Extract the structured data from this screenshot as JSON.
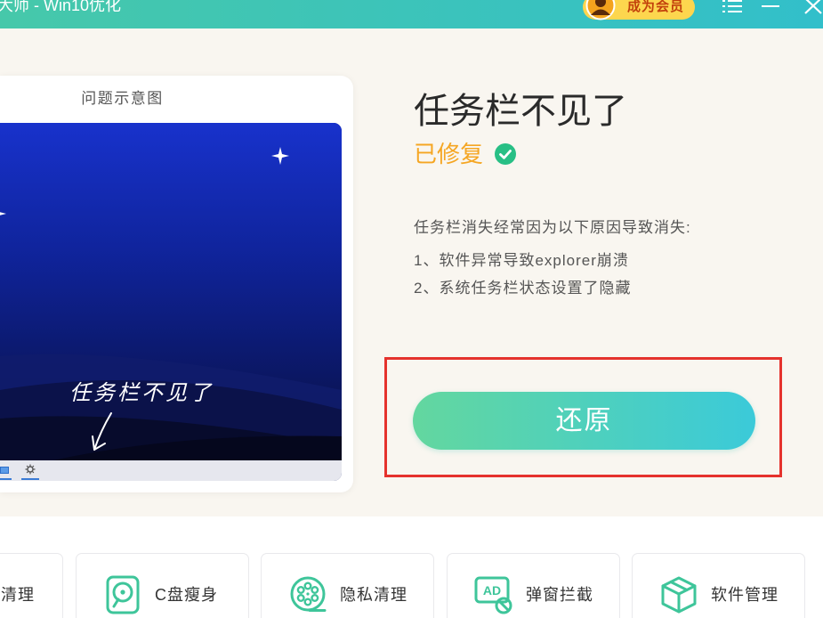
{
  "window": {
    "title": "大师 - Win10优化",
    "vip_label": "成为会员",
    "icons": {
      "avatar": "avatar-icon",
      "menu": "menu-icon",
      "minimize": "minimize-icon",
      "close": "close-icon"
    }
  },
  "preview": {
    "title": "问题示意图",
    "caption": "任务栏不见了",
    "icons": {
      "star": "star-icon",
      "arrow": "arrow-icon",
      "taskbar_app": "taskbar-app-icon",
      "taskbar_settings": "gear-icon"
    }
  },
  "issue": {
    "title": "任务栏不见了",
    "status": "已修复",
    "status_icon": "check-circle-icon",
    "intro": "任务栏消失经常因为以下原因导致消失:",
    "reasons": [
      "1、软件异常导致explorer崩溃",
      "2、系统任务栏状态设置了隐藏"
    ],
    "action_label": "还原"
  },
  "tools": [
    {
      "label": "清理"
    },
    {
      "label": "C盘瘦身",
      "icon": "c-drive-icon"
    },
    {
      "label": "隐私清理",
      "icon": "film-reel-icon"
    },
    {
      "label": "弹窗拦截",
      "icon": "ad-block-icon",
      "icon_text": "AD"
    },
    {
      "label": "软件管理",
      "icon": "cube-icon"
    }
  ],
  "colors": {
    "title-bar-start": "#46c8aa",
    "title-bar-end": "#32bfca",
    "vip-gold": "#fdd64e",
    "vip-text": "#c2410c",
    "accent-orange": "#f5a623",
    "success-green": "#28bf85",
    "highlight-red": "#e5322d",
    "button-start": "#63d79f",
    "button-end": "#3bcad9",
    "icon-green": "#3ec59a",
    "page-bg": "#f9f6f0"
  }
}
